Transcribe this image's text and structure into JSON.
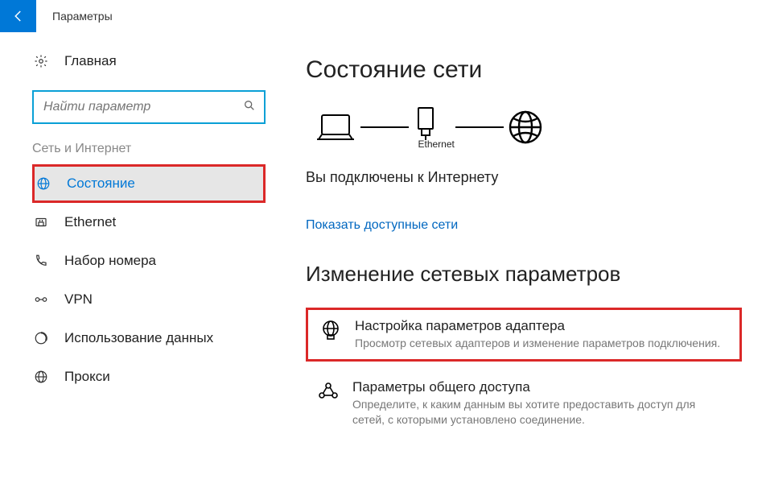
{
  "titlebar": {
    "title": "Параметры"
  },
  "sidebar": {
    "home_label": "Главная",
    "search_placeholder": "Найти параметр",
    "group_label": "Сеть и Интернет",
    "items": [
      {
        "label": "Состояние"
      },
      {
        "label": "Ethernet"
      },
      {
        "label": "Набор номера"
      },
      {
        "label": "VPN"
      },
      {
        "label": "Использование данных"
      },
      {
        "label": "Прокси"
      }
    ]
  },
  "content": {
    "heading": "Состояние сети",
    "ethernet_label": "Ethernet",
    "connected_text": "Вы подключены к Интернету",
    "show_networks_link": "Показать доступные сети",
    "subheading": "Изменение сетевых параметров",
    "options": [
      {
        "title": "Настройка параметров адаптера",
        "desc": "Просмотр сетевых адаптеров и изменение параметров подключения."
      },
      {
        "title": "Параметры общего доступа",
        "desc": "Определите, к каким данным вы хотите предоставить доступ для сетей, с которыми установлено соединение."
      }
    ]
  }
}
